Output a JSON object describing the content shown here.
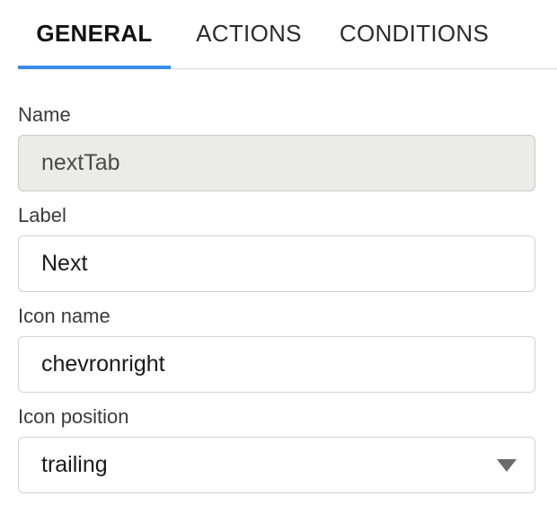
{
  "tabs": [
    {
      "label": "GENERAL",
      "active": true
    },
    {
      "label": "ACTIONS",
      "active": false
    },
    {
      "label": "CONDITIONS",
      "active": false
    }
  ],
  "accent_color": "#3b8be8",
  "form": {
    "name": {
      "label": "Name",
      "value": "nextTab",
      "disabled": true
    },
    "label": {
      "label": "Label",
      "value": "Next"
    },
    "icon_name": {
      "label": "Icon name",
      "value": "chevronright"
    },
    "icon_position": {
      "label": "Icon position",
      "value": "trailing",
      "icon": "chevron-down-icon"
    }
  }
}
